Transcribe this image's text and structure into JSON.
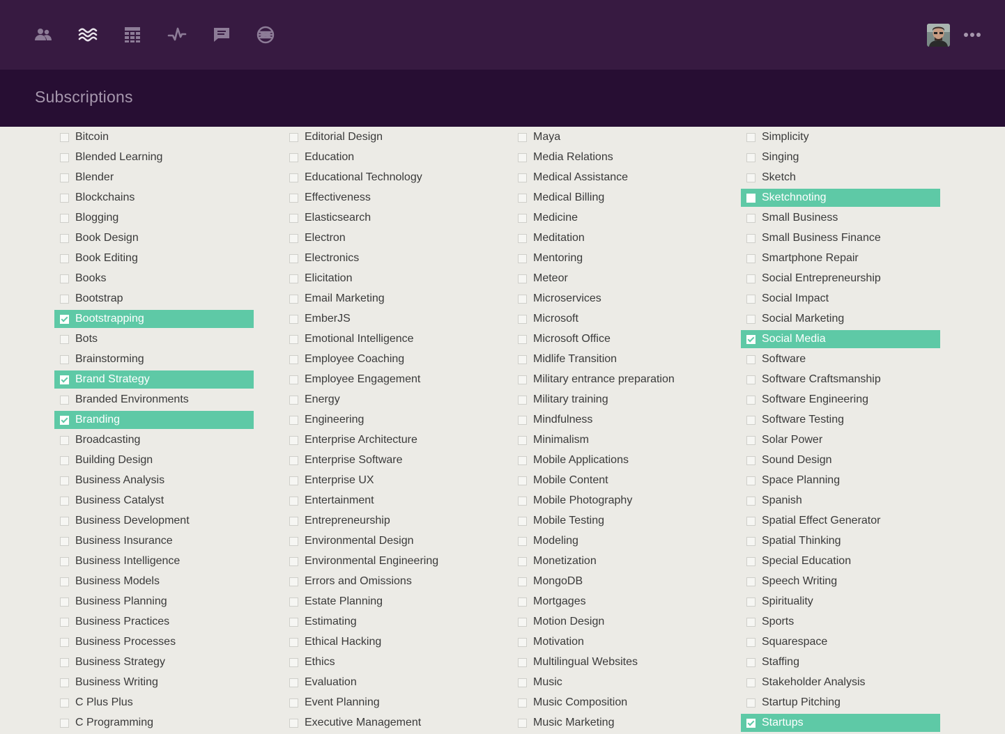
{
  "nav": {
    "icons": [
      "people-icon",
      "waves-icon",
      "grid-icon",
      "activity-icon",
      "chat-icon",
      "globe-icon"
    ],
    "more_label": "•••"
  },
  "header": {
    "title": "Subscriptions"
  },
  "colors": {
    "topbar": "#371a41",
    "header": "#270e33",
    "accent": "#5ec9a6",
    "background": "#ecebe6"
  },
  "columns": [
    [
      {
        "label": "Bitcoin",
        "checked": false
      },
      {
        "label": "Blended Learning",
        "checked": false
      },
      {
        "label": "Blender",
        "checked": false
      },
      {
        "label": "Blockchains",
        "checked": false
      },
      {
        "label": "Blogging",
        "checked": false
      },
      {
        "label": "Book Design",
        "checked": false
      },
      {
        "label": "Book Editing",
        "checked": false
      },
      {
        "label": "Books",
        "checked": false
      },
      {
        "label": "Bootstrap",
        "checked": false
      },
      {
        "label": "Bootstrapping",
        "checked": true
      },
      {
        "label": "Bots",
        "checked": false
      },
      {
        "label": "Brainstorming",
        "checked": false
      },
      {
        "label": "Brand Strategy",
        "checked": true
      },
      {
        "label": "Branded Environments",
        "checked": false
      },
      {
        "label": "Branding",
        "checked": true
      },
      {
        "label": "Broadcasting",
        "checked": false
      },
      {
        "label": "Building Design",
        "checked": false
      },
      {
        "label": "Business Analysis",
        "checked": false
      },
      {
        "label": "Business Catalyst",
        "checked": false
      },
      {
        "label": "Business Development",
        "checked": false
      },
      {
        "label": "Business Insurance",
        "checked": false
      },
      {
        "label": "Business Intelligence",
        "checked": false
      },
      {
        "label": "Business Models",
        "checked": false
      },
      {
        "label": "Business Planning",
        "checked": false
      },
      {
        "label": "Business Practices",
        "checked": false
      },
      {
        "label": "Business Processes",
        "checked": false
      },
      {
        "label": "Business Strategy",
        "checked": false
      },
      {
        "label": "Business Writing",
        "checked": false
      },
      {
        "label": "C Plus Plus",
        "checked": false
      },
      {
        "label": "C Programming",
        "checked": false
      }
    ],
    [
      {
        "label": "Editorial Design",
        "checked": false
      },
      {
        "label": "Education",
        "checked": false
      },
      {
        "label": "Educational Technology",
        "checked": false
      },
      {
        "label": "Effectiveness",
        "checked": false
      },
      {
        "label": "Elasticsearch",
        "checked": false
      },
      {
        "label": "Electron",
        "checked": false
      },
      {
        "label": "Electronics",
        "checked": false
      },
      {
        "label": "Elicitation",
        "checked": false
      },
      {
        "label": "Email Marketing",
        "checked": false
      },
      {
        "label": "EmberJS",
        "checked": false
      },
      {
        "label": "Emotional Intelligence",
        "checked": false
      },
      {
        "label": "Employee Coaching",
        "checked": false
      },
      {
        "label": "Employee Engagement",
        "checked": false
      },
      {
        "label": "Energy",
        "checked": false
      },
      {
        "label": "Engineering",
        "checked": false
      },
      {
        "label": "Enterprise Architecture",
        "checked": false
      },
      {
        "label": "Enterprise Software",
        "checked": false
      },
      {
        "label": "Enterprise UX",
        "checked": false
      },
      {
        "label": "Entertainment",
        "checked": false
      },
      {
        "label": "Entrepreneurship",
        "checked": false
      },
      {
        "label": "Environmental Design",
        "checked": false
      },
      {
        "label": "Environmental Engineering",
        "checked": false
      },
      {
        "label": "Errors and Omissions",
        "checked": false
      },
      {
        "label": "Estate Planning",
        "checked": false
      },
      {
        "label": "Estimating",
        "checked": false
      },
      {
        "label": "Ethical Hacking",
        "checked": false
      },
      {
        "label": "Ethics",
        "checked": false
      },
      {
        "label": "Evaluation",
        "checked": false
      },
      {
        "label": "Event Planning",
        "checked": false
      },
      {
        "label": "Executive Management",
        "checked": false
      }
    ],
    [
      {
        "label": "Maya",
        "checked": false
      },
      {
        "label": "Media Relations",
        "checked": false
      },
      {
        "label": "Medical Assistance",
        "checked": false
      },
      {
        "label": "Medical Billing",
        "checked": false
      },
      {
        "label": "Medicine",
        "checked": false
      },
      {
        "label": "Meditation",
        "checked": false
      },
      {
        "label": "Mentoring",
        "checked": false
      },
      {
        "label": "Meteor",
        "checked": false
      },
      {
        "label": "Microservices",
        "checked": false
      },
      {
        "label": "Microsoft",
        "checked": false
      },
      {
        "label": "Microsoft Office",
        "checked": false
      },
      {
        "label": "Midlife Transition",
        "checked": false
      },
      {
        "label": "Military entrance preparation",
        "checked": false
      },
      {
        "label": "Military training",
        "checked": false
      },
      {
        "label": "Mindfulness",
        "checked": false
      },
      {
        "label": "Minimalism",
        "checked": false
      },
      {
        "label": "Mobile Applications",
        "checked": false
      },
      {
        "label": "Mobile Content",
        "checked": false
      },
      {
        "label": "Mobile Photography",
        "checked": false
      },
      {
        "label": "Mobile Testing",
        "checked": false
      },
      {
        "label": "Modeling",
        "checked": false
      },
      {
        "label": "Monetization",
        "checked": false
      },
      {
        "label": "MongoDB",
        "checked": false
      },
      {
        "label": "Mortgages",
        "checked": false
      },
      {
        "label": "Motion Design",
        "checked": false
      },
      {
        "label": "Motivation",
        "checked": false
      },
      {
        "label": "Multilingual Websites",
        "checked": false
      },
      {
        "label": "Music",
        "checked": false
      },
      {
        "label": "Music Composition",
        "checked": false
      },
      {
        "label": "Music Marketing",
        "checked": false
      }
    ],
    [
      {
        "label": "Simplicity",
        "checked": false
      },
      {
        "label": "Singing",
        "checked": false
      },
      {
        "label": "Sketch",
        "checked": false
      },
      {
        "label": "Sketchnoting",
        "checked": true,
        "partial": true
      },
      {
        "label": "Small Business",
        "checked": false
      },
      {
        "label": "Small Business Finance",
        "checked": false
      },
      {
        "label": "Smartphone Repair",
        "checked": false
      },
      {
        "label": "Social Entrepreneurship",
        "checked": false
      },
      {
        "label": "Social Impact",
        "checked": false
      },
      {
        "label": "Social Marketing",
        "checked": false
      },
      {
        "label": "Social Media",
        "checked": true
      },
      {
        "label": "Software",
        "checked": false
      },
      {
        "label": "Software Craftsmanship",
        "checked": false
      },
      {
        "label": "Software Engineering",
        "checked": false
      },
      {
        "label": "Software Testing",
        "checked": false
      },
      {
        "label": "Solar Power",
        "checked": false
      },
      {
        "label": "Sound Design",
        "checked": false
      },
      {
        "label": "Space Planning",
        "checked": false
      },
      {
        "label": "Spanish",
        "checked": false
      },
      {
        "label": "Spatial Effect Generator",
        "checked": false
      },
      {
        "label": "Spatial Thinking",
        "checked": false
      },
      {
        "label": "Special Education",
        "checked": false
      },
      {
        "label": "Speech Writing",
        "checked": false
      },
      {
        "label": "Spirituality",
        "checked": false
      },
      {
        "label": "Sports",
        "checked": false
      },
      {
        "label": "Squarespace",
        "checked": false
      },
      {
        "label": "Staffing",
        "checked": false
      },
      {
        "label": "Stakeholder Analysis",
        "checked": false
      },
      {
        "label": "Startup Pitching",
        "checked": false
      },
      {
        "label": "Startups",
        "checked": true
      }
    ]
  ]
}
